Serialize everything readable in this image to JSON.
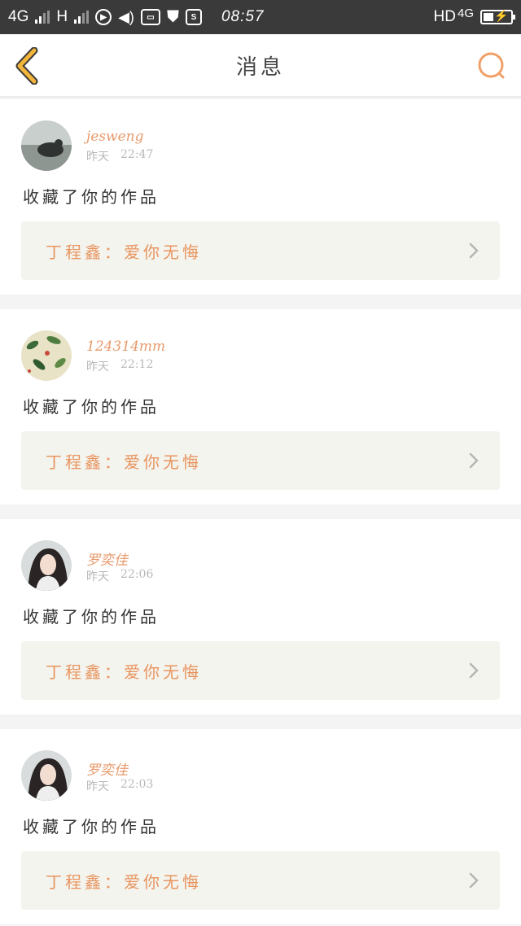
{
  "status_bar": {
    "network_1": "4G",
    "network_2": "H",
    "time": "08:57",
    "hd": "HD",
    "network_right": "4G"
  },
  "header": {
    "title": "消息",
    "back_icon": "chevron-left-icon",
    "search_icon": "search-icon"
  },
  "colors": {
    "accent": "#e8945e",
    "background": "#f4f4f4",
    "work_box": "#f4f4ef"
  },
  "messages": [
    {
      "username": "jesweng",
      "day": "昨天",
      "time": "22:47",
      "action": "收藏了你的作品",
      "work": "丁程鑫：爱你无悔"
    },
    {
      "username": "124314mm",
      "day": "昨天",
      "time": "22:12",
      "action": "收藏了你的作品",
      "work": "丁程鑫：爱你无悔"
    },
    {
      "username": "罗奕佳",
      "day": "昨天",
      "time": "22:06",
      "action": "收藏了你的作品",
      "work": "丁程鑫：爱你无悔"
    },
    {
      "username": "罗奕佳",
      "day": "昨天",
      "time": "22:03",
      "action": "收藏了你的作品",
      "work": "丁程鑫：爱你无悔"
    }
  ]
}
